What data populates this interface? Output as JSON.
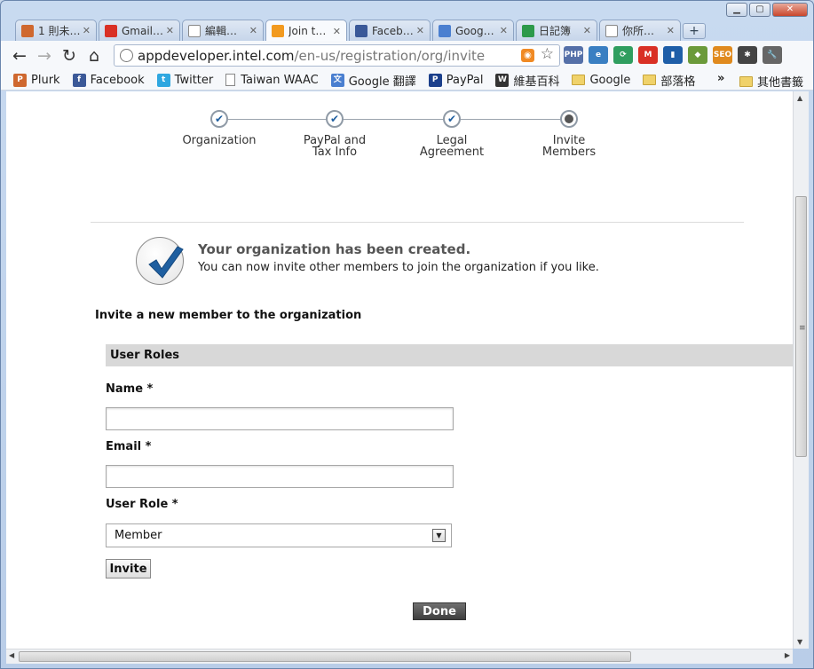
{
  "browser": {
    "tabs": [
      {
        "label": "1 則未…",
        "icon": "plurk-icon",
        "color": "#cf682f",
        "active": false
      },
      {
        "label": "Gmail…",
        "icon": "gmail-icon",
        "color": "#d93025",
        "active": false
      },
      {
        "label": "編輯…",
        "icon": "document-icon",
        "color": "#ffffff",
        "active": false
      },
      {
        "label": "Join t…",
        "icon": "intel-icon",
        "color": "#f29a1f",
        "active": true
      },
      {
        "label": "Faceb…",
        "icon": "facebook-icon",
        "color": "#3b5998",
        "active": false
      },
      {
        "label": "Goog…",
        "icon": "google-docs-icon",
        "color": "#4a7fd0",
        "active": false
      },
      {
        "label": "日記簿",
        "icon": "spreadsheet-icon",
        "color": "#2d9a4a",
        "active": false
      },
      {
        "label": "你所…",
        "icon": "document-icon",
        "color": "#ffffff",
        "active": false
      }
    ],
    "address": {
      "host": "appdeveloper.intel.com",
      "path": "/en-us/registration/org/invite"
    },
    "extensions": [
      {
        "name": "php-icon",
        "text": "PHP",
        "color": "#5570a8"
      },
      {
        "name": "ie-tab-icon",
        "text": "e",
        "color": "#3a7fc2"
      },
      {
        "name": "sync-icon",
        "text": "⟳",
        "color": "#2f9e5f"
      },
      {
        "name": "gmail-checker-icon",
        "text": "M",
        "color": "#d93025"
      },
      {
        "name": "stats-icon",
        "text": "▮",
        "color": "#1e5ea8"
      },
      {
        "name": "clip-icon",
        "text": "◆",
        "color": "#6b9a3a"
      },
      {
        "name": "seo-icon",
        "text": "SEO",
        "color": "#e08a1e"
      },
      {
        "name": "bug-icon",
        "text": "✱",
        "color": "#444444"
      },
      {
        "name": "wrench-icon",
        "text": "🔧",
        "color": "#666666"
      }
    ],
    "bookmarks": [
      {
        "label": "Plurk",
        "icon": "plurk-icon",
        "type": "site",
        "color": "#cf682f",
        "glyph": "P"
      },
      {
        "label": "Facebook",
        "icon": "facebook-icon",
        "type": "site",
        "color": "#3b5998",
        "glyph": "f"
      },
      {
        "label": "Twitter",
        "icon": "twitter-icon",
        "type": "site",
        "color": "#2fa7e0",
        "glyph": "t"
      },
      {
        "label": "Taiwan WAAC",
        "icon": "document-icon",
        "type": "doc",
        "color": "#ffffff",
        "glyph": ""
      },
      {
        "label": "Google 翻譯",
        "icon": "translate-icon",
        "type": "site",
        "color": "#4a7fd0",
        "glyph": "文"
      },
      {
        "label": "PayPal",
        "icon": "paypal-icon",
        "type": "site",
        "color": "#1b3f8b",
        "glyph": "P"
      },
      {
        "label": "維基百科",
        "icon": "wikipedia-icon",
        "type": "site",
        "color": "#333333",
        "glyph": "W"
      },
      {
        "label": "Google",
        "icon": "folder-icon",
        "type": "folder",
        "color": "#f0d26a",
        "glyph": ""
      },
      {
        "label": "部落格",
        "icon": "folder-icon",
        "type": "folder",
        "color": "#f0d26a",
        "glyph": ""
      }
    ],
    "bookmarks_overflow": "»",
    "other_bookmarks": "其他書籤"
  },
  "page": {
    "steps": [
      {
        "label": "Organization",
        "state": "done"
      },
      {
        "label": "PayPal and\nTax Info",
        "state": "done"
      },
      {
        "label": "Legal\nAgreement",
        "state": "done"
      },
      {
        "label": "Invite\nMembers",
        "state": "current"
      }
    ],
    "success": {
      "title": "Your organization has been created.",
      "message": "You can now invite other members to join the organization if you like."
    },
    "invite_heading": "Invite a new member to the organization",
    "roles_section": "User Roles",
    "form": {
      "name_label": "Name *",
      "name_value": "",
      "email_label": "Email *",
      "email_value": "",
      "role_label": "User Role *",
      "role_selected": "Member"
    },
    "invite_button": "Invite",
    "done_button": "Done"
  },
  "colors": {
    "accent": "#1f5fa0",
    "roles_bar": "#d8d8d8",
    "done_button": "#4a4a4a"
  }
}
